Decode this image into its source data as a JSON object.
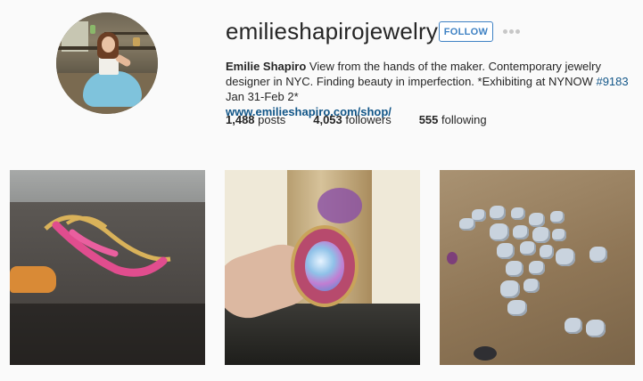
{
  "profile": {
    "username": "emilieshapirojewelry",
    "follow_label": "FOLLOW",
    "more_icon": "ellipsis-icon",
    "bio": {
      "name": "Emilie Shapiro",
      "text_before_tag": " View from the hands of the maker. Contemporary jewelry designer in NYC. Finding beauty in imperfection. *Exhibiting at NYNOW ",
      "hashtag": "#9183",
      "text_after_tag": " Jan 31-Feb 2*",
      "website": "www.emilieshapiro.com/shop/"
    },
    "stats": [
      {
        "count": "1,488",
        "label": " posts"
      },
      {
        "count": "4,053",
        "label": " followers"
      },
      {
        "count": "555",
        "label": " following"
      }
    ]
  },
  "colors": {
    "link": "#125688",
    "follow_accent": "#3f82c4",
    "background": "#fafafa"
  }
}
